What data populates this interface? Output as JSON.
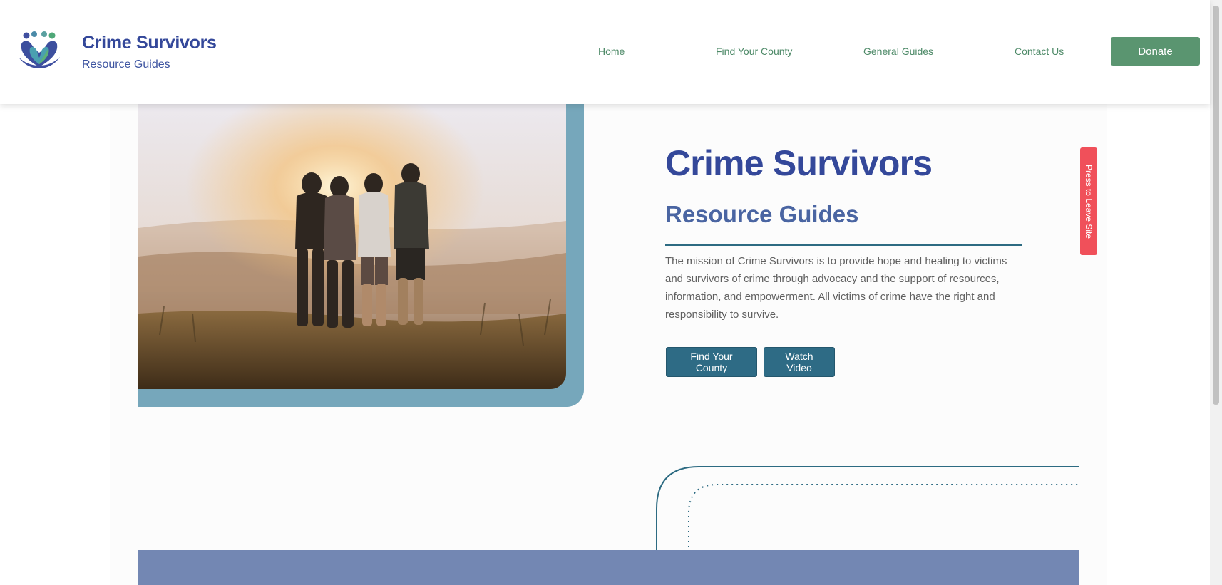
{
  "header": {
    "brand_title": "Crime Survivors",
    "brand_subtitle": "Resource Guides",
    "nav": [
      {
        "label": "Home"
      },
      {
        "label": "Find Your County"
      },
      {
        "label": "General Guides"
      },
      {
        "label": "Contact Us"
      }
    ],
    "donate_label": "Donate"
  },
  "hero": {
    "title": "Crime Survivors",
    "subtitle": "Resource Guides",
    "description": "The mission of Crime Survivors is to provide hope and healing to victims and survivors of crime through advocacy and the support of resources, information, and empowerment. All victims of crime have the right and responsibility to survive.",
    "buttons": [
      {
        "label": "Find Your County"
      },
      {
        "label": "Watch Video"
      }
    ]
  },
  "leave_site": {
    "label": "Press to Leave Site"
  },
  "colors": {
    "brand_blue": "#34489a",
    "nav_green": "#4e8a68",
    "donate_green": "#5a9570",
    "cta_teal": "#2e6b85",
    "frame_teal": "#76a7bb",
    "leave_red": "#f0505a"
  },
  "icons": {
    "logo": "heart-people-logo-icon"
  }
}
